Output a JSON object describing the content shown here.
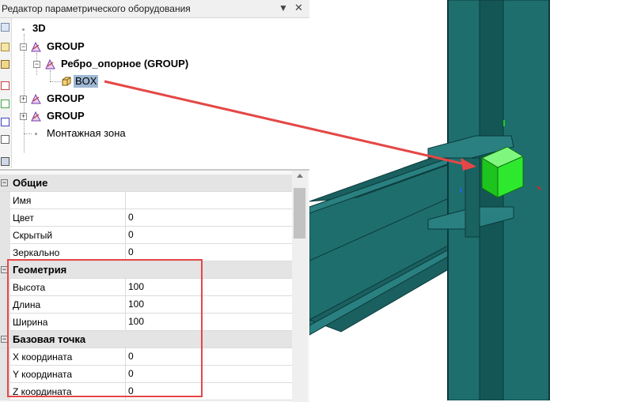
{
  "panel": {
    "title": "Редактор параметрического оборудования",
    "pin_icon": "pin-icon",
    "close_icon": "close-icon"
  },
  "toolbar": {
    "icons": [
      "zoom-icon",
      "properties-icon",
      "find-icon",
      "axis-x-icon",
      "axis-y-icon",
      "axis-z-icon",
      "axis-xyz-icon",
      "layers-icon"
    ]
  },
  "tree": {
    "root": "3D",
    "group1": "GROUP",
    "subgroup": "Ребро_опорное (GROUP)",
    "box": "BOX",
    "group2": "GROUP",
    "group3": "GROUP",
    "zone": "Монтажная зона"
  },
  "props": {
    "cat_general": "Общие",
    "rows_general": [
      {
        "name": "Имя",
        "value": ""
      },
      {
        "name": "Цвет",
        "value": "0"
      },
      {
        "name": "Скрытый",
        "value": "0"
      },
      {
        "name": "Зеркально",
        "value": "0"
      }
    ],
    "cat_geometry": "Геометрия",
    "rows_geometry": [
      {
        "name": "Высота",
        "value": "100"
      },
      {
        "name": "Длина",
        "value": "100"
      },
      {
        "name": "Ширина",
        "value": "100"
      }
    ],
    "cat_base": "Базовая точка",
    "rows_base": [
      {
        "name": "X координата",
        "value": "0"
      },
      {
        "name": "Y координата",
        "value": "0"
      },
      {
        "name": "Z координата",
        "value": "0"
      }
    ]
  },
  "colors": {
    "steel": "#1f6e6e",
    "steel_dark": "#0f4848",
    "steel_edge": "#0a3a3a",
    "box_green": "#2ee82e",
    "annotation_red": "#e54747",
    "selection": "#9eb7d4"
  }
}
